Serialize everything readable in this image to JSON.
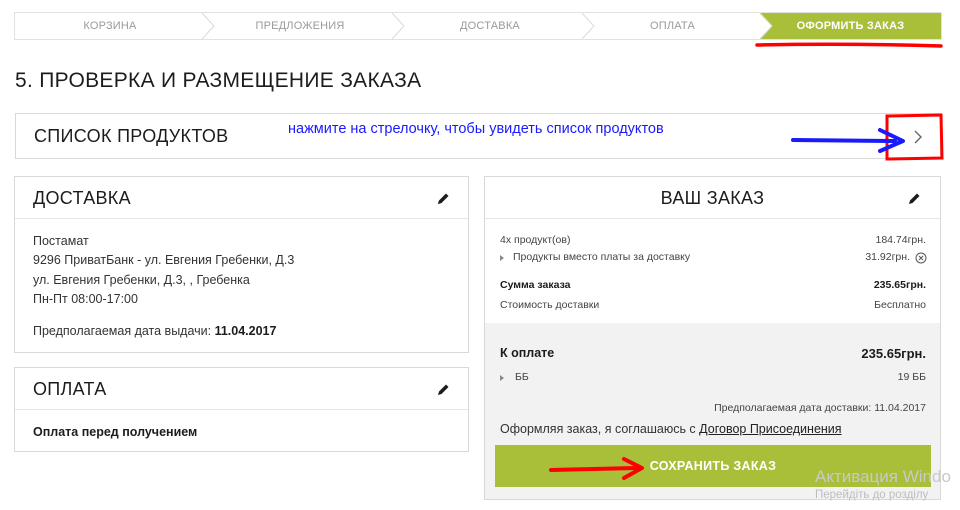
{
  "steps": [
    {
      "label": "КОРЗИНА",
      "active": false
    },
    {
      "label": "ПРЕДЛОЖЕНИЯ",
      "active": false
    },
    {
      "label": "ДОСТАВКА",
      "active": false
    },
    {
      "label": "ОПЛАТА",
      "active": false
    },
    {
      "label": "ОФОРМИТЬ ЗАКАЗ",
      "active": true
    }
  ],
  "page_title": "5. ПРОВЕРКА И РАЗМЕЩЕНИЕ ЗАКАЗА",
  "products": {
    "title": "СПИСОК ПРОДУКТОВ",
    "annotation": "нажмите на стрелочку, чтобы увидеть список продуктов",
    "expand_icon": "chevron-right-icon"
  },
  "delivery": {
    "title": "ДОСТАВКА",
    "lines": [
      "Постамат",
      "9296 ПриватБанк - ул. Евгения Гребенки, Д.3",
      "ул. Евгения Гребенки, Д.3, , Гребенка",
      "Пн-Пт 08:00-17:00"
    ],
    "issue_date_label": "Предполагаемая дата выдачи: ",
    "issue_date_value": "11.04.2017"
  },
  "payment": {
    "title": "ОПЛАТА",
    "method": "Оплата перед получением"
  },
  "order": {
    "title": "ВАШ ЗАКАЗ",
    "products_label": "4х продукт(ов)",
    "products_value": "184.74грн.",
    "instead_label": "Продукты вместо платы за доставку",
    "instead_value": "31.92грн.",
    "sum_label": "Сумма заказа",
    "sum_value": "235.65грн.",
    "shipping_label": "Стоимость доставки",
    "shipping_value": "Бесплатно",
    "pay_label": "К оплате",
    "pay_value": "235.65грн.",
    "bb_label": "ББ",
    "bb_value": "19 ББ",
    "delivery_date": "Предполагаемая дата доставки: 11.04.2017",
    "agree_text": "Оформляя заказ, я соглашаюсь с ",
    "agree_link": "Договор Присоединения",
    "save_label": "СОХРАНИТЬ ЗАКАЗ"
  },
  "watermark": {
    "line1": "Активация Windo",
    "line2": "Перейдіть до розділу"
  },
  "colors": {
    "accent": "#a9bf3a",
    "annotation_red": "#ff0000",
    "annotation_blue": "#1a1aff"
  }
}
